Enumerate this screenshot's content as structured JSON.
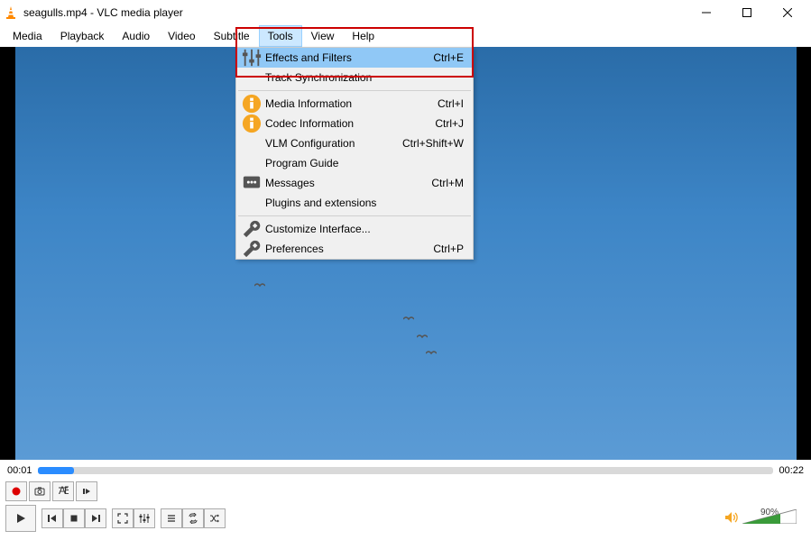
{
  "title": "seagulls.mp4 - VLC media player",
  "menubar": {
    "items": [
      "Media",
      "Playback",
      "Audio",
      "Video",
      "Subtitle",
      "Tools",
      "View",
      "Help"
    ],
    "active_index": 5
  },
  "dropdown": {
    "items": [
      {
        "icon": "sliders",
        "label": "Effects and Filters",
        "shortcut": "Ctrl+E",
        "highlight": true
      },
      {
        "icon": "",
        "label": "Track Synchronization",
        "shortcut": "",
        "highlight": false
      },
      {
        "sep": true
      },
      {
        "icon": "info",
        "label": "Media Information",
        "shortcut": "Ctrl+I",
        "highlight": false
      },
      {
        "icon": "info",
        "label": "Codec Information",
        "shortcut": "Ctrl+J",
        "highlight": false
      },
      {
        "icon": "",
        "label": "VLM Configuration",
        "shortcut": "Ctrl+Shift+W",
        "highlight": false
      },
      {
        "icon": "",
        "label": "Program Guide",
        "shortcut": "",
        "highlight": false
      },
      {
        "icon": "messages",
        "label": "Messages",
        "shortcut": "Ctrl+M",
        "highlight": false
      },
      {
        "icon": "",
        "label": "Plugins and extensions",
        "shortcut": "",
        "highlight": false
      },
      {
        "sep": true
      },
      {
        "icon": "wrench",
        "label": "Customize Interface...",
        "shortcut": "",
        "highlight": false
      },
      {
        "icon": "wrench",
        "label": "Preferences",
        "shortcut": "Ctrl+P",
        "highlight": false
      }
    ]
  },
  "time": {
    "current": "00:01",
    "total": "00:22"
  },
  "volume": {
    "percent": "90%"
  }
}
